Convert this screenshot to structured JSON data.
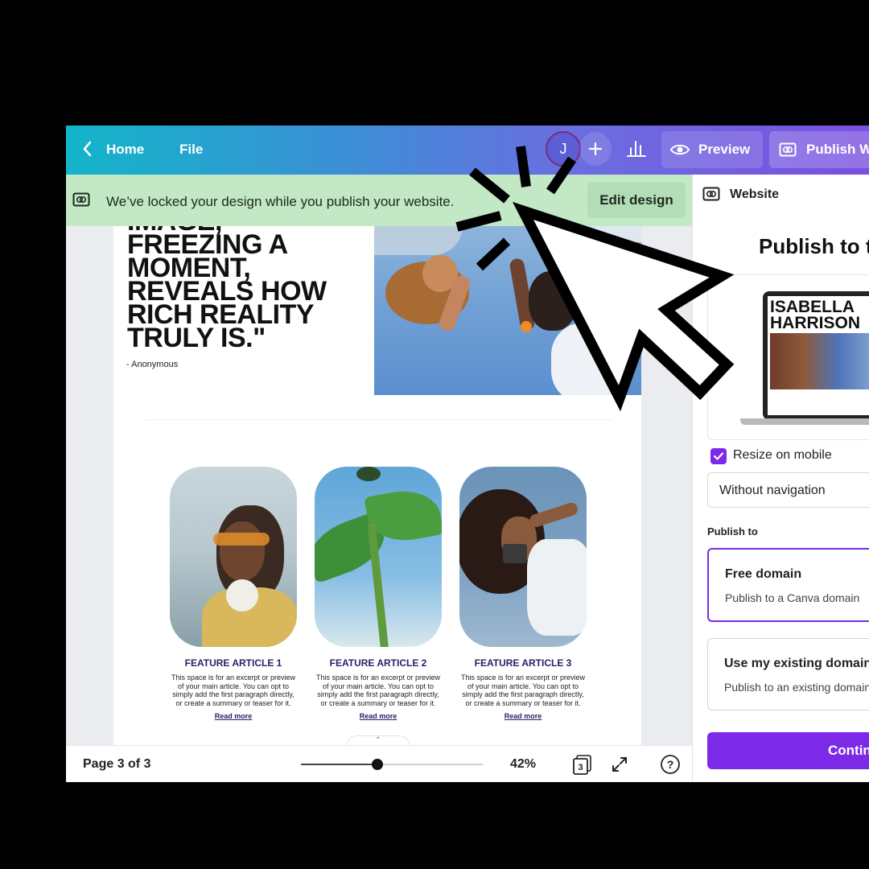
{
  "topbar": {
    "home_label": "Home",
    "file_label": "File",
    "avatar_initial": "J",
    "preview_label": "Preview",
    "publish_label": "Publish Website"
  },
  "notice": {
    "message": "We’ve locked your design while you publish your website.",
    "edit_label": "Edit design"
  },
  "design": {
    "quote": "IMAGE,\nFREEZING A\nMOMENT,\nREVEALS HOW\nRICH REALITY\nTRULY IS.\"",
    "author": "- Anonymous",
    "cards": [
      {
        "title": "FEATURE ARTICLE 1",
        "body": "This space is for an excerpt or preview of your main article. You can opt to simply add the first paragraph directly, or create a summary or teaser for it.",
        "link": "Read more"
      },
      {
        "title": "FEATURE ARTICLE 2",
        "body": "This space is for an excerpt or preview of your main article. You can opt to simply add the first paragraph directly, or create a summary or teaser for it.",
        "link": "Read more"
      },
      {
        "title": "FEATURE ARTICLE 3",
        "body": "This space is for an excerpt or preview of your main article. You can opt to simply add the first paragraph directly, or create a summary or teaser for it.",
        "link": "Read more"
      }
    ]
  },
  "bottombar": {
    "page_label": "Page 3 of 3",
    "zoom_label": "42%",
    "zoom_percent": 42,
    "pages_count": "3"
  },
  "panel": {
    "header": "Website",
    "title": "Publish to the web",
    "preview_name": "ISABELLA\nHARRISON",
    "resize_label": "Resize on mobile",
    "resize_checked": true,
    "navigation_value": "Without navigation",
    "publish_to_label": "Publish to",
    "options": [
      {
        "title": "Free domain",
        "subtitle": "Publish to a Canva domain"
      },
      {
        "title": "Use my existing domain",
        "subtitle": "Publish to an existing domain"
      }
    ],
    "continue_label": "Continue"
  },
  "colors": {
    "accent": "#7d2ae8",
    "notice_bg": "#c2e8c5",
    "brand_gradient_start": "#12b5c9",
    "brand_gradient_end": "#7b4fe0"
  }
}
